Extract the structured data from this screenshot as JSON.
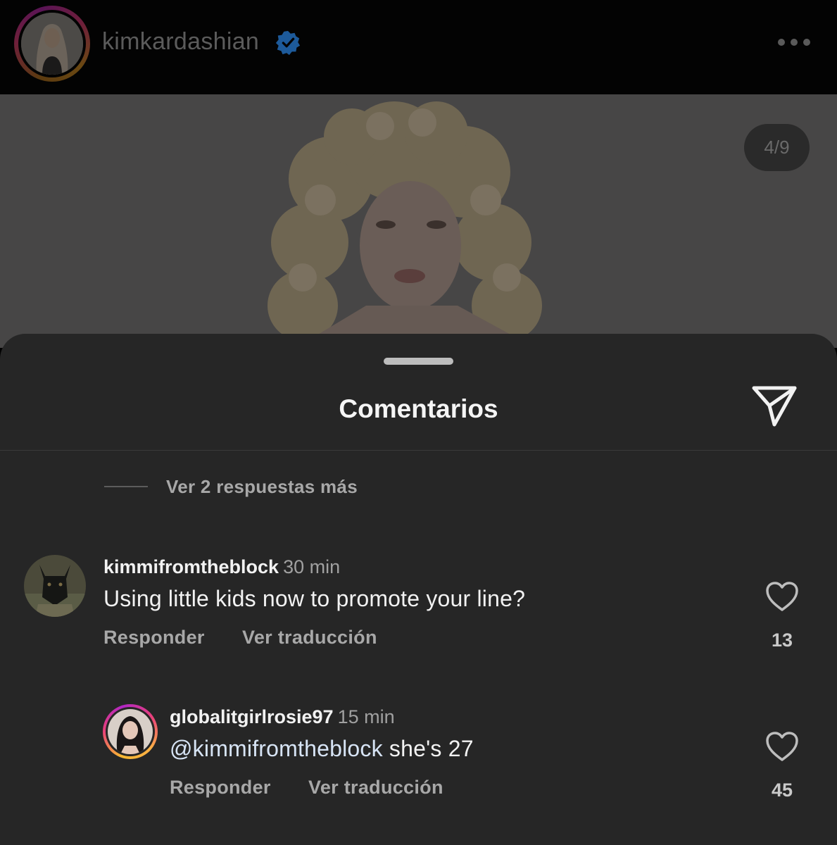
{
  "header": {
    "username": "kimkardashian",
    "verified": true,
    "more_icon": "more-horizontal-icon"
  },
  "post": {
    "page_counter": "4/9"
  },
  "sheet": {
    "title": "Comentarios",
    "share_icon": "paper-plane-icon",
    "view_replies": "Ver 2 respuestas más"
  },
  "comments": [
    {
      "username": "kimmifromtheblock",
      "time": "30 min",
      "text": "Using little kids now to promote your line?",
      "reply_label": "Responder",
      "translate_label": "Ver traducción",
      "like_count": "13"
    },
    {
      "username": "globalitgirlrosie97",
      "time": "15 min",
      "mention": "@kimmifromtheblock",
      "text": " she's 27",
      "reply_label": "Responder",
      "translate_label": "Ver traducción",
      "like_count": "45"
    }
  ],
  "colors": {
    "sheet_bg": "#262626",
    "verified_blue": "#1d5a9a",
    "mention": "#d7e4f5"
  }
}
